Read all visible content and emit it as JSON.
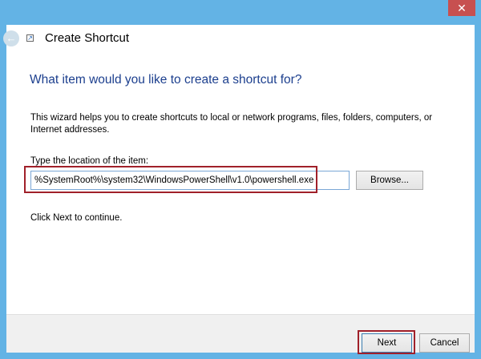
{
  "window": {
    "title": "Create Shortcut",
    "close_glyph": "✕",
    "back_glyph": "←"
  },
  "page": {
    "heading": "What item would you like to create a shortcut for?",
    "description": "This wizard helps you to create shortcuts to local or network programs, files, folders, computers, or Internet addresses.",
    "field_label": "Type the location of the item:",
    "location_value": "%SystemRoot%\\system32\\WindowsPowerShell\\v1.0\\powershell.exe",
    "browse_label": "Browse...",
    "continue_text": "Click Next to continue."
  },
  "footer": {
    "next_label": "Next",
    "cancel_label": "Cancel"
  },
  "colors": {
    "window_frame": "#63b3e5",
    "heading": "#1c3f8e",
    "highlight": "#a0202a",
    "close_button": "#c75050"
  }
}
